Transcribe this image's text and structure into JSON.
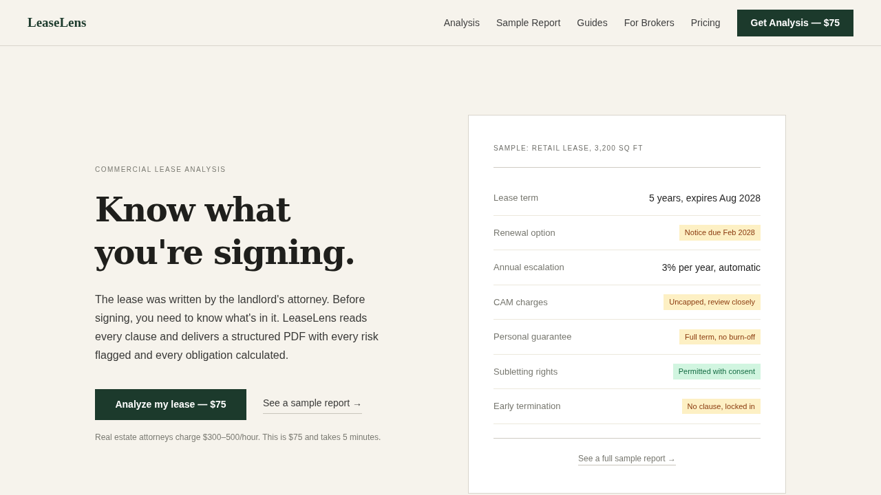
{
  "brand": "LeaseLens",
  "nav": [
    "Analysis",
    "Sample Report",
    "Guides",
    "For Brokers",
    "Pricing"
  ],
  "nav_cta": "Get Analysis — $75",
  "hero": {
    "eyebrow": "COMMERCIAL LEASE ANALYSIS",
    "title_lines": [
      "Know what",
      "you're signing."
    ],
    "body": "The lease was written by the landlord's attorney. Before signing, you need to know what's in it. LeaseLens reads every clause and delivers a structured PDF with every risk flagged and every obligation calculated.",
    "cta": "Analyze my lease — $75",
    "link": "See a sample report →",
    "note": "Real estate attorneys charge $300–500/hour. This is $75 and takes 5 minutes."
  },
  "sample": {
    "title": "SAMPLE: RETAIL LEASE, 3,200 SQ FT",
    "rows": [
      {
        "label": "Lease term",
        "value": "5 years, expires Aug 2028",
        "kind": "text"
      },
      {
        "label": "Renewal option",
        "value": "Notice due Feb 2028",
        "kind": "warning"
      },
      {
        "label": "Annual escalation",
        "value": "3% per year, automatic",
        "kind": "text"
      },
      {
        "label": "CAM charges",
        "value": "Uncapped, review closely",
        "kind": "warning"
      },
      {
        "label": "Personal guarantee",
        "value": "Full term, no burn-off",
        "kind": "warning"
      },
      {
        "label": "Subletting rights",
        "value": "Permitted with consent",
        "kind": "ok"
      },
      {
        "label": "Early termination",
        "value": "No clause, locked in",
        "kind": "warning"
      }
    ],
    "link": "See a full sample report →"
  }
}
